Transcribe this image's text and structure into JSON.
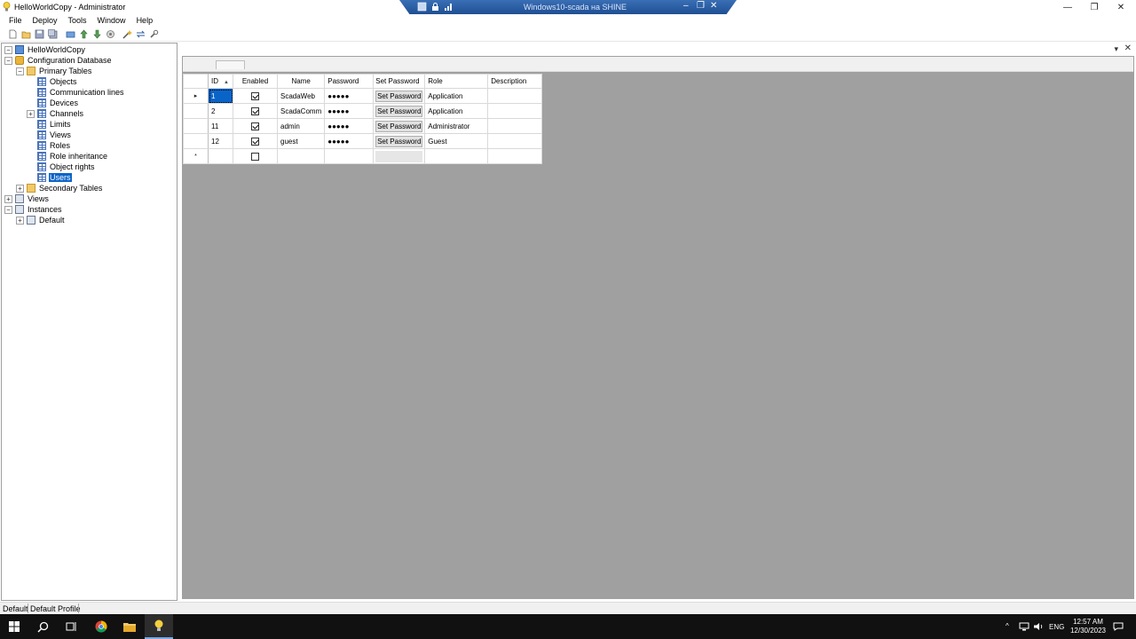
{
  "window": {
    "title": "HelloWorldCopy - Administrator",
    "minimize": "—",
    "restore": "❐",
    "close": "✕"
  },
  "rdp": {
    "title": "Windows10-scada на SHINE",
    "minimize": "–",
    "restore": "❐",
    "close": "✕"
  },
  "menu": {
    "file": "File",
    "deploy": "Deploy",
    "tools": "Tools",
    "window": "Window",
    "help": "Help"
  },
  "tree": {
    "root": "HelloWorldCopy",
    "config_db": "Configuration Database",
    "primary_tables": "Primary Tables",
    "primary_items": [
      "Objects",
      "Communication lines",
      "Devices",
      "Channels",
      "Limits",
      "Views",
      "Roles",
      "Role inheritance",
      "Object rights",
      "Users"
    ],
    "secondary_tables": "Secondary Tables",
    "views": "Views",
    "instances": "Instances",
    "default_instance": "Default"
  },
  "grid": {
    "columns": [
      "ID",
      "Enabled",
      "Name",
      "Password",
      "Set Password",
      "Role",
      "Description"
    ],
    "rows": [
      {
        "id": "1",
        "enabled": true,
        "name": "ScadaWeb",
        "password": "●●●●●",
        "set_password": "Set Password",
        "role": "Application",
        "description": ""
      },
      {
        "id": "2",
        "enabled": true,
        "name": "ScadaComm",
        "password": "●●●●●",
        "set_password": "Set Password",
        "role": "Application",
        "description": ""
      },
      {
        "id": "11",
        "enabled": true,
        "name": "admin",
        "password": "●●●●●",
        "set_password": "Set Password",
        "role": "Administrator",
        "description": ""
      },
      {
        "id": "12",
        "enabled": true,
        "name": "guest",
        "password": "●●●●●",
        "set_password": "Set Password",
        "role": "Guest",
        "description": ""
      }
    ],
    "current_row_marker": "▸",
    "new_row_marker": "*"
  },
  "status": {
    "instance": "Default",
    "profile": "Default Profile"
  },
  "tray": {
    "language": "ENG",
    "time": "12:57 AM",
    "date": "12/30/2023"
  },
  "colors": {
    "selection": "#0a64c8",
    "grid_background": "#a0a0a0",
    "taskbar": "#111111",
    "rdp_bar": "#2a5ea6"
  }
}
